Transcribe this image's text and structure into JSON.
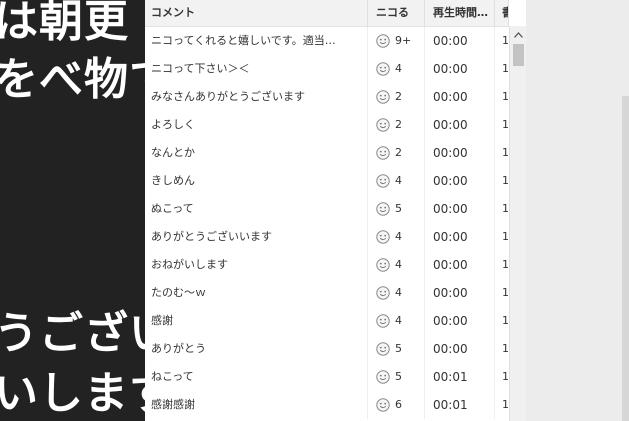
{
  "video": {
    "overlay_lines": [
      "は朝更",
      "をべ物て",
      "うござい",
      "いします"
    ]
  },
  "header": {
    "comment": "コメント",
    "niko": "ニコる",
    "time": "再生時間…",
    "write": "書込"
  },
  "rows": [
    {
      "comment": "ニコってくれると嬉しいです。適当…",
      "niko": "9+",
      "time": "00:00",
      "write": "1"
    },
    {
      "comment": "ニコって下さい＞＜",
      "niko": "4",
      "time": "00:00",
      "write": "1"
    },
    {
      "comment": "みなさんありがとうございます",
      "niko": "2",
      "time": "00:00",
      "write": "1"
    },
    {
      "comment": "よろしく",
      "niko": "2",
      "time": "00:00",
      "write": "1"
    },
    {
      "comment": "なんとか",
      "niko": "2",
      "time": "00:00",
      "write": "1"
    },
    {
      "comment": "きしめん",
      "niko": "4",
      "time": "00:00",
      "write": "1"
    },
    {
      "comment": "ぬこって",
      "niko": "5",
      "time": "00:00",
      "write": "1"
    },
    {
      "comment": "ありがとうございいます",
      "niko": "4",
      "time": "00:00",
      "write": "1"
    },
    {
      "comment": "おねがいします",
      "niko": "4",
      "time": "00:00",
      "write": "1"
    },
    {
      "comment": "たのむ〜ｗ",
      "niko": "4",
      "time": "00:00",
      "write": "1"
    },
    {
      "comment": "感謝",
      "niko": "4",
      "time": "00:00",
      "write": "1"
    },
    {
      "comment": "ありがとう",
      "niko": "5",
      "time": "00:00",
      "write": "1"
    },
    {
      "comment": "ねこって",
      "niko": "5",
      "time": "00:01",
      "write": "1"
    },
    {
      "comment": "感謝感謝",
      "niko": "6",
      "time": "00:01",
      "write": "1"
    }
  ],
  "icons": {
    "niko": "smiley-face-icon",
    "scroll_up": "chevron-up-icon"
  },
  "colors": {
    "video_bg": "#222222",
    "header_bg": "#f2f2f2",
    "scroll_thumb": "#c3c3c3"
  }
}
